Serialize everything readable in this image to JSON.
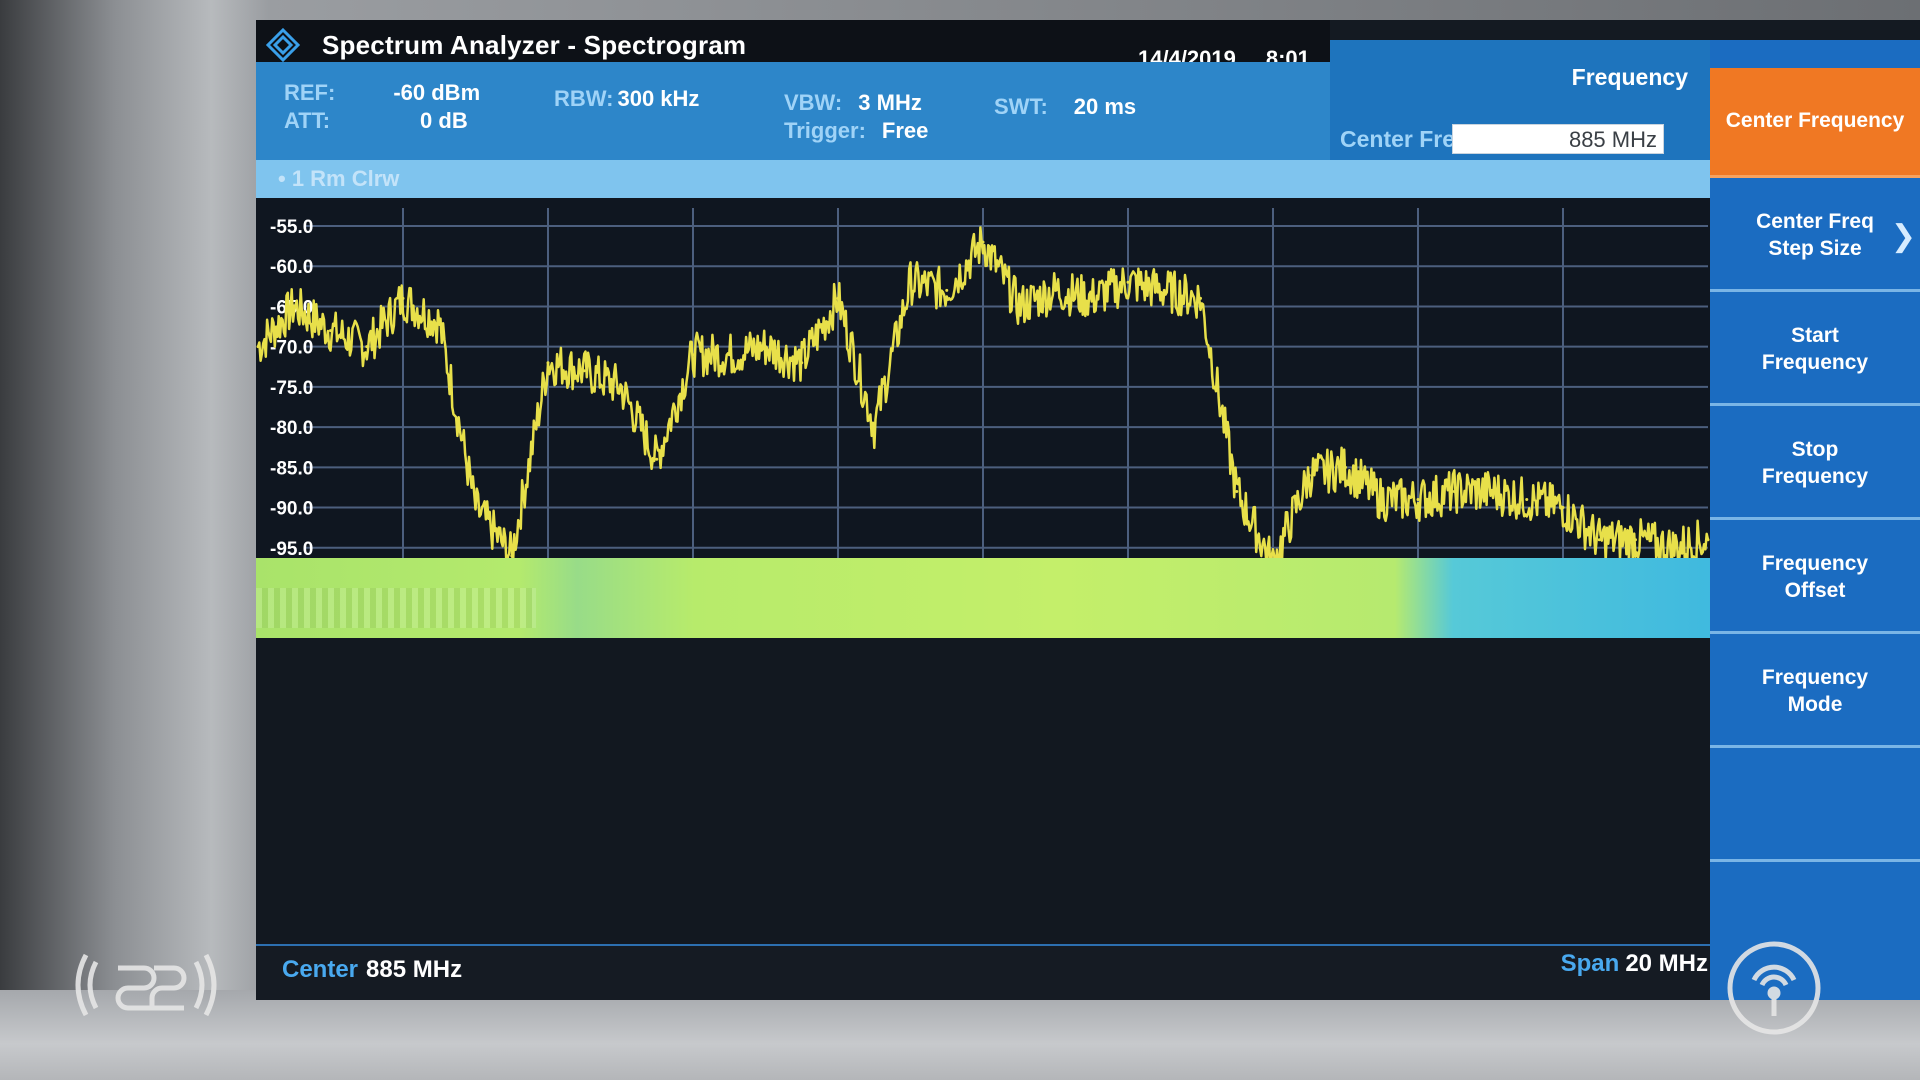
{
  "window": {
    "title": "Spectrum Analyzer - Spectrogram",
    "date": "14/4/2019",
    "time": "8:01"
  },
  "settings": {
    "ref": {
      "label": "REF:",
      "value": "-60 dBm"
    },
    "att": {
      "label": "ATT:",
      "value": "0 dB"
    },
    "rbw": {
      "label": "RBW:",
      "value": "300 kHz"
    },
    "vbw": {
      "label": "VBW:",
      "value": "3 MHz"
    },
    "trigger": {
      "label": "Trigger:",
      "value": "Free"
    },
    "swt": {
      "label": "SWT:",
      "value": "20 ms"
    }
  },
  "trace_info": "• 1 Rm  Clrw",
  "frequency_panel": {
    "title": "Frequency",
    "center_freq_label": "Center Freq",
    "center_freq_value": "885 MHz"
  },
  "softkeys": [
    {
      "label": "Center Frequency",
      "active": true
    },
    {
      "label": "Center Freq Step Size",
      "has_submenu": true
    },
    {
      "label": "Start Frequency"
    },
    {
      "label": "Stop Frequency"
    },
    {
      "label": "Frequency Offset"
    },
    {
      "label": "Frequency Mode"
    },
    {
      "label": ""
    }
  ],
  "footer": {
    "center_label": "Center",
    "center_value": "885 MHz",
    "span_label": "Span",
    "span_value": "20 MHz"
  },
  "colors": {
    "trace": "#e8e04a",
    "accent_active": "#f07823",
    "panel_blue": "#1b6cc1",
    "settings_blue": "#2d86c9",
    "grid": "#4c5f7e"
  },
  "chart_data": {
    "type": "line",
    "ylabel": "",
    "xlabel": "",
    "y_ticks": [
      "-55.0",
      "-60.0",
      "-65.0",
      "-70.0",
      "-75.0",
      "-80.0",
      "-85.0",
      "-90.0",
      "-95.0"
    ],
    "ylim": [
      -100,
      -55
    ],
    "x_unit": "MHz",
    "xlim": [
      875,
      895
    ],
    "grid": true,
    "series": [
      {
        "x": [
          875,
          875.5,
          876,
          876.5,
          877,
          877.5,
          878,
          878.5,
          879,
          879.5,
          880,
          880.5,
          881,
          881.5,
          882,
          882.5,
          883,
          883.5,
          884,
          884.5,
          885,
          885.5,
          886,
          886.5,
          887,
          887.5,
          888,
          888.5,
          889,
          889.5,
          890,
          890.5,
          891,
          891.5,
          892,
          892.5,
          893,
          893.5,
          894,
          894.5,
          895
        ],
        "values": [
          -70,
          -65,
          -68,
          -70,
          -64,
          -67,
          -90,
          -96,
          -72,
          -73,
          -75,
          -84,
          -71,
          -71,
          -70,
          -72,
          -64,
          -80,
          -62,
          -63,
          -57,
          -65,
          -63,
          -64,
          -62,
          -63,
          -64,
          -88,
          -97,
          -86,
          -85,
          -89,
          -89,
          -88,
          -88,
          -89,
          -90,
          -94,
          -94,
          -95,
          -94
        ]
      }
    ]
  }
}
